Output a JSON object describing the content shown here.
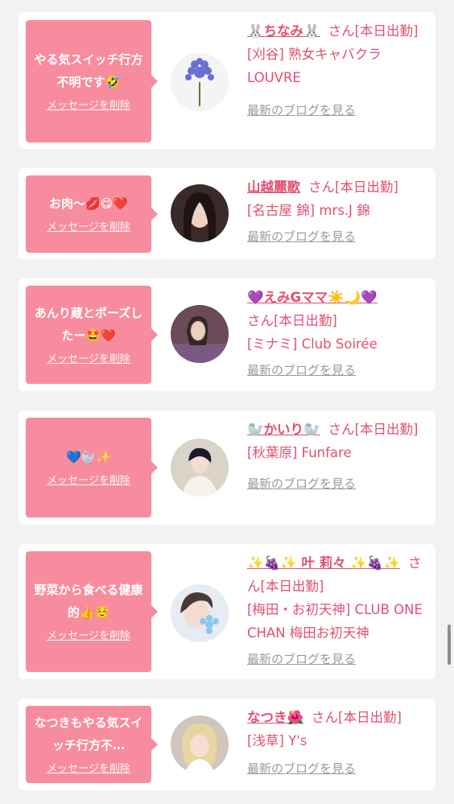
{
  "cards": [
    {
      "message": "やる気スイッチ行方不明です🤣",
      "delete_label": "メッセージを削除",
      "name": "🐰ちなみ🐰",
      "honorific": "さん",
      "status": "[本日出勤]",
      "shop": "[刈谷] 熟女キャバクラ LOUVRE",
      "blog_link": "最新のブログを見る"
    },
    {
      "message": "お肉〜💋😋❤️",
      "delete_label": "メッセージを削除",
      "name": "山越麗歌",
      "honorific": "さん",
      "status": "[本日出勤]",
      "shop": "[名古屋 錦] mrs.J 錦",
      "blog_link": "最新のブログを見る"
    },
    {
      "message": "あんり蔵とポーズしたー🤩❤️",
      "delete_label": "メッセージを削除",
      "name": "💜えみGママ☀️🌙💜",
      "honorific": "さん",
      "status": "[本日出勤]",
      "shop": "[ミナミ] Club Soirée",
      "blog_link": "最新のブログを見る"
    },
    {
      "message": "💙🦭✨",
      "delete_label": "メッセージを削除",
      "name": "🦭かいり🦭",
      "honorific": "さん",
      "status": "[本日出勤]",
      "shop": "[秋葉原] Funfare",
      "blog_link": "最新のブログを見る"
    },
    {
      "message": "野菜から食べる健康的👍☺️",
      "delete_label": "メッセージを削除",
      "name": "✨🍇✨ 叶 莉々 ✨🍇✨",
      "honorific": "さん",
      "status": "[本日出勤]",
      "shop": "[梅田・お初天神] CLUB ONE CHAN 梅田お初天神",
      "blog_link": "最新のブログを見る"
    },
    {
      "message": "なつきもやる気スイッチ行方不…",
      "delete_label": "メッセージを削除",
      "name": "なつき🌺",
      "honorific": "さん",
      "status": "[本日出勤]",
      "shop": "[浅草] Y's",
      "blog_link": "最新のブログを見る"
    }
  ],
  "colors": {
    "bubble": "#f78c9e",
    "name": "#e0516f",
    "link": "#9a9a9a",
    "background": "#f2f2f2"
  }
}
